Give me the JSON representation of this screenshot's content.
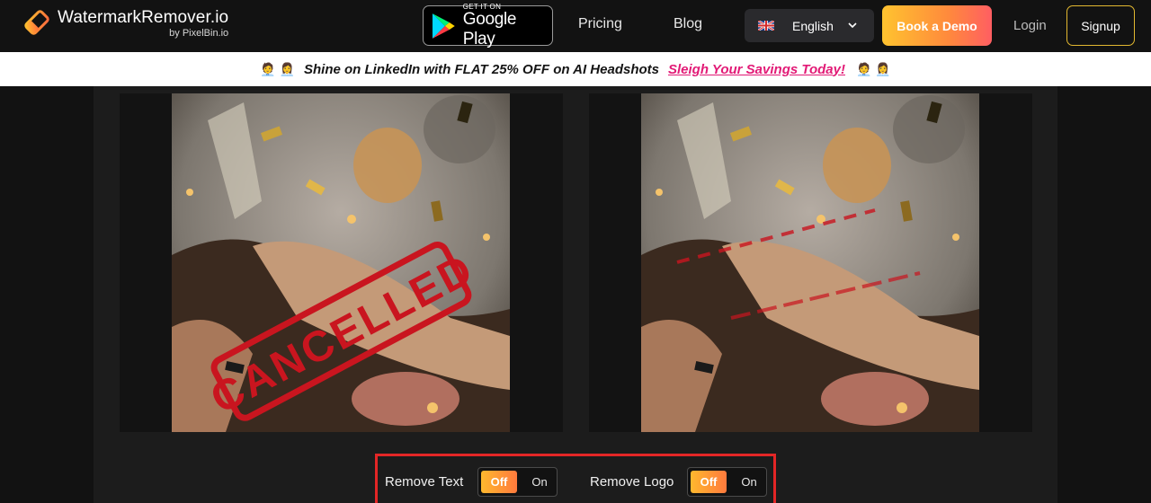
{
  "header": {
    "brand": "WatermarkRemover.io",
    "brand_sub": "by PixelBin.io",
    "store_small": "GET IT ON",
    "store_big": "Google Play",
    "nav": [
      {
        "label": "Pricing"
      },
      {
        "label": "Blog"
      }
    ],
    "language": "English",
    "demo_label": "Book a Demo",
    "login_label": "Login",
    "signup_label": "Signup"
  },
  "banner": {
    "emoji_left": "🧑‍💼 👩‍💼",
    "text": "Shine on LinkedIn with FLAT 25% OFF on AI Headshots",
    "link": "Sleigh Your Savings Today!",
    "emoji_right": "🧑‍💼 👩‍💼"
  },
  "images": {
    "watermark_text": "CANCELLED"
  },
  "controls": {
    "remove_text_label": "Remove Text",
    "remove_logo_label": "Remove Logo",
    "off_label": "Off",
    "on_label": "On"
  },
  "colors": {
    "accent_gradient_start": "#ffc32f",
    "accent_gradient_end": "#ff5e62",
    "promo_link": "#e21a76",
    "highlight_border": "#e32626"
  },
  "icons": {
    "logo": "eraser-logo-icon",
    "store": "google-play-icon",
    "flag": "uk-flag-icon",
    "dropdown": "chevron-down-icon"
  }
}
